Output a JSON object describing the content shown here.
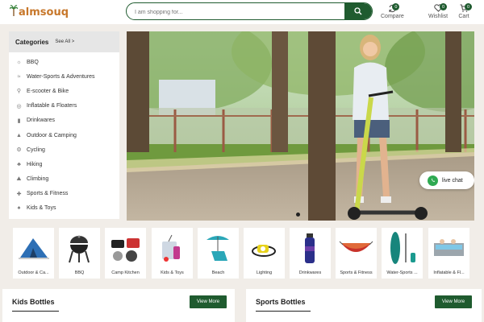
{
  "header": {
    "logo_text": "almsouq",
    "logo_prefix": "P",
    "search_placeholder": "I am shopping for...",
    "compare_label": "Compare",
    "compare_count": "0",
    "wishlist_label": "Wishlist",
    "wishlist_count": "0",
    "cart_label": "Cart",
    "cart_count": "0"
  },
  "categories": {
    "title": "Categories",
    "see_all": "See All >",
    "items": [
      {
        "label": "BBQ",
        "icon": "bbq-icon"
      },
      {
        "label": "Water-Sports & Adventures",
        "icon": "water-sports-icon"
      },
      {
        "label": "E-scooter & Bike",
        "icon": "scooter-icon"
      },
      {
        "label": "Inflatable & Floaters",
        "icon": "float-icon"
      },
      {
        "label": "Drinkwares",
        "icon": "bottle-icon"
      },
      {
        "label": "Outdoor & Camping",
        "icon": "tent-icon"
      },
      {
        "label": "Cycling",
        "icon": "bike-icon"
      },
      {
        "label": "Hiking",
        "icon": "hiking-icon"
      },
      {
        "label": "Climbing",
        "icon": "climbing-icon"
      },
      {
        "label": "Sports & Fitness",
        "icon": "fitness-icon"
      },
      {
        "label": "Kids & Toys",
        "icon": "toys-icon"
      }
    ]
  },
  "hero": {
    "chat_label": "live chat"
  },
  "tiles": [
    {
      "label": "Outdoor & Ca..."
    },
    {
      "label": "BBQ"
    },
    {
      "label": "Camp Kitchen"
    },
    {
      "label": "Kids & Toys"
    },
    {
      "label": "Beach"
    },
    {
      "label": "Lighting"
    },
    {
      "label": "Drinkwares"
    },
    {
      "label": "Sports & Fitness"
    },
    {
      "label": "Water-Sports ..."
    },
    {
      "label": "Inflatable & Fl..."
    }
  ],
  "sections": {
    "kids": {
      "title": "Kids Bottles",
      "button": "View More"
    },
    "sports": {
      "title": "Sports Bottles",
      "button": "View More"
    }
  },
  "colors": {
    "brand_green": "#1f5b2f",
    "logo_orange": "#c7772a",
    "background": "#f1ede8"
  }
}
